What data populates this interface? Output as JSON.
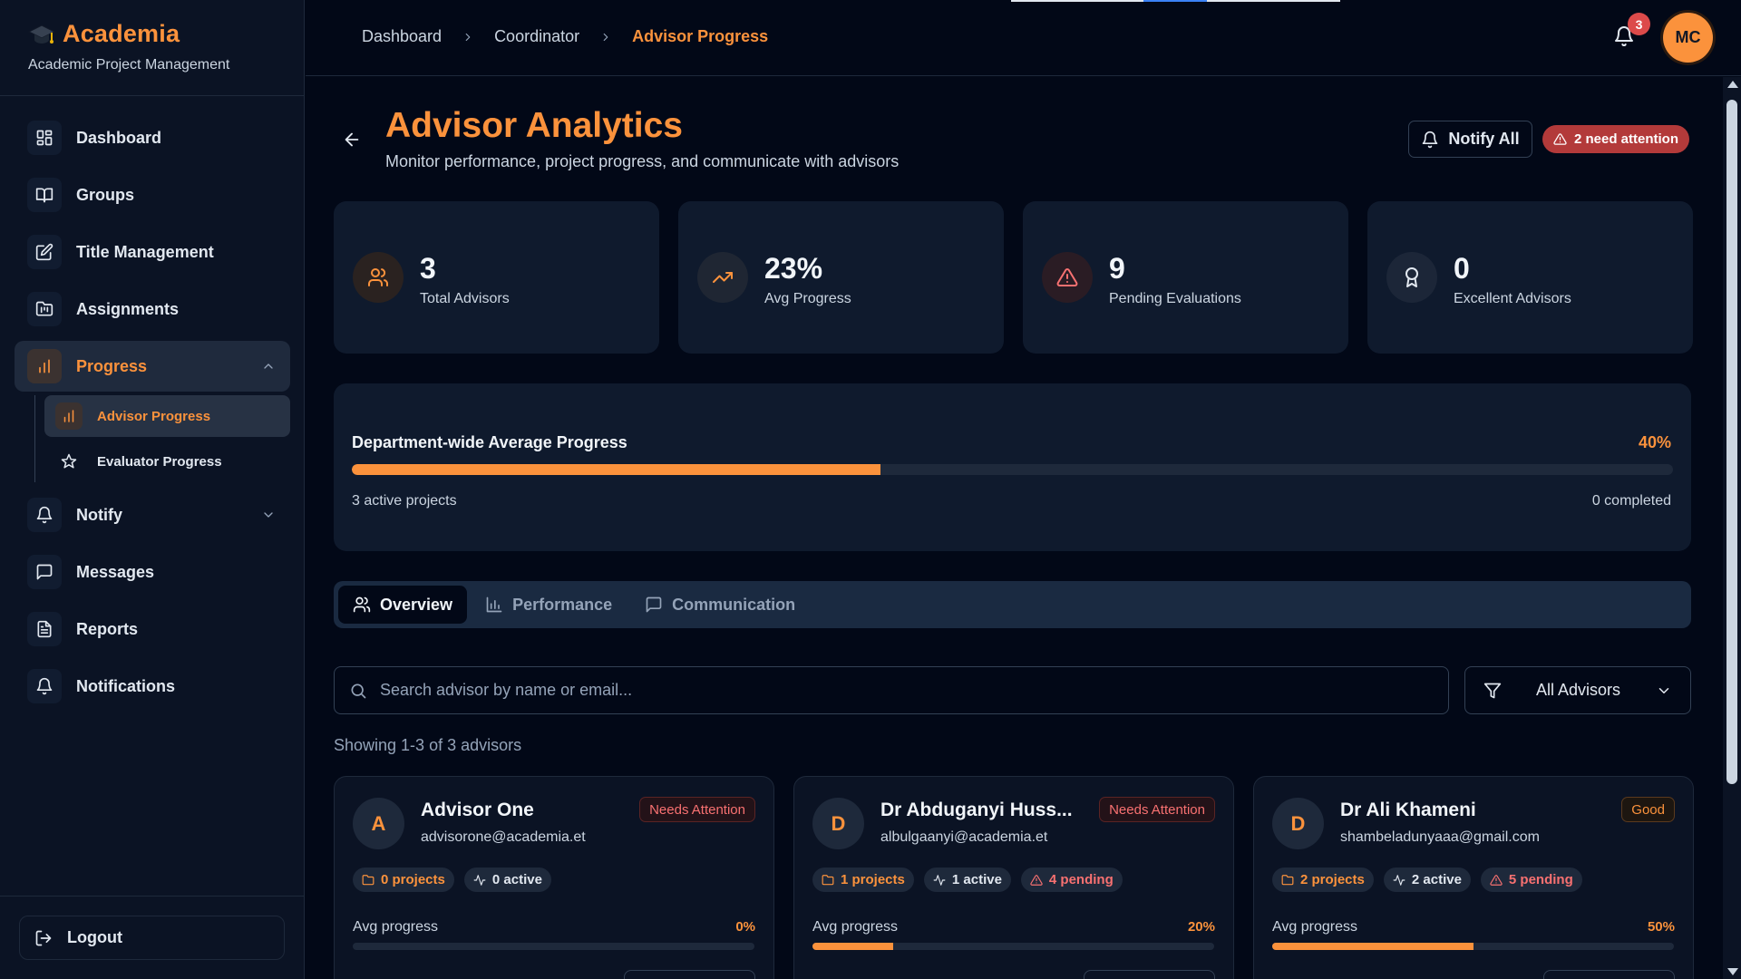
{
  "brand": {
    "name": "Academia",
    "subtitle": "Academic Project Management",
    "icon": "graduation-cap-icon"
  },
  "sidebar": {
    "items": [
      {
        "label": "Dashboard",
        "icon": "layout-grid-icon"
      },
      {
        "label": "Groups",
        "icon": "book-open-icon"
      },
      {
        "label": "Title Management",
        "icon": "edit-icon"
      },
      {
        "label": "Assignments",
        "icon": "folder-kanban-icon"
      },
      {
        "label": "Progress",
        "icon": "bar-chart-icon",
        "expanded": true
      },
      {
        "label": "Notify",
        "icon": "bell-icon",
        "expanded": false
      },
      {
        "label": "Messages",
        "icon": "message-square-icon"
      },
      {
        "label": "Reports",
        "icon": "file-text-icon"
      },
      {
        "label": "Notifications",
        "icon": "bell-icon"
      }
    ],
    "progress_sub": [
      {
        "label": "Advisor Progress",
        "icon": "bar-chart-icon",
        "active": true
      },
      {
        "label": "Evaluator Progress",
        "icon": "star-icon"
      }
    ],
    "logout_label": "Logout"
  },
  "topbar": {
    "breadcrumbs": [
      "Dashboard",
      "Coordinator",
      "Advisor Progress"
    ],
    "notification_count": "3",
    "avatar_initials": "MC"
  },
  "header": {
    "title": "Advisor Analytics",
    "subtitle": "Monitor performance, project progress, and communicate with advisors",
    "notify_all_label": "Notify All",
    "attention_label": "2 need attention"
  },
  "stats": [
    {
      "value": "3",
      "label": "Total Advisors",
      "icon": "users-icon"
    },
    {
      "value": "23%",
      "label": "Avg Progress",
      "icon": "trending-up-icon"
    },
    {
      "value": "9",
      "label": "Pending Evaluations",
      "icon": "alert-triangle-icon"
    },
    {
      "value": "0",
      "label": "Excellent Advisors",
      "icon": "award-icon"
    }
  ],
  "department": {
    "title": "Department-wide Average Progress",
    "percent_label": "40%",
    "progress": 0.4,
    "active_projects": "3 active projects",
    "completed": "0 completed"
  },
  "tabs": [
    {
      "label": "Overview",
      "icon": "users-icon",
      "active": true
    },
    {
      "label": "Performance",
      "icon": "bar-chart-icon"
    },
    {
      "label": "Communication",
      "icon": "message-square-icon"
    }
  ],
  "search": {
    "placeholder": "Search advisor by name or email...",
    "value": ""
  },
  "filter": {
    "selected": "All Advisors"
  },
  "showing_text": "Showing 1-3 of 3 advisors",
  "advisors": [
    {
      "initial": "A",
      "name": "Advisor One",
      "email": "advisorone@academia.et",
      "status": "Needs Attention",
      "status_kind": "attn",
      "projects": "0 projects",
      "active": "0 active",
      "pending": "",
      "progress_label": "Avg progress",
      "progress_value": "0%",
      "progress": 0
    },
    {
      "initial": "D",
      "name": "Dr Abduganyi Huss...",
      "email": "albulgaanyi@academia.et",
      "status": "Needs Attention",
      "status_kind": "attn",
      "projects": "1 projects",
      "active": "1 active",
      "pending": "4 pending",
      "progress_label": "Avg progress",
      "progress_value": "20%",
      "progress": 0.2
    },
    {
      "initial": "D",
      "name": "Dr Ali Khameni",
      "email": "shambeladunyaaa@gmail.com",
      "status": "Good",
      "status_kind": "good",
      "projects": "2 projects",
      "active": "2 active",
      "pending": "5 pending",
      "progress_label": "Avg progress",
      "progress_value": "50%",
      "progress": 0.5
    }
  ],
  "colors": {
    "accent": "#fb923c",
    "danger": "#dc4a4a",
    "background": "#020817",
    "card": "#0f1a2d"
  }
}
